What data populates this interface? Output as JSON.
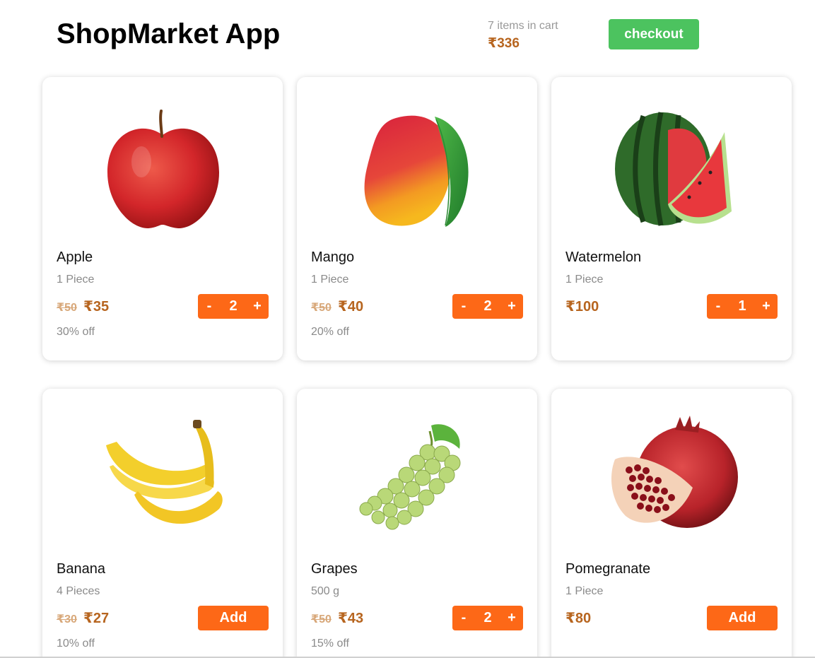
{
  "header": {
    "title": "ShopMarket App",
    "cart_count": "7 items in cart",
    "cart_total": "₹336",
    "checkout_label": "checkout"
  },
  "colors": {
    "accent_orange": "#fd6817",
    "checkout_green": "#4cc35f",
    "price_brown": "#b7651f"
  },
  "products": [
    {
      "name": "Apple",
      "unit": "1 Piece",
      "mrp": "₹50",
      "price": "₹35",
      "discount": "30% off",
      "qty": "2",
      "icon": "apple-icon"
    },
    {
      "name": "Mango",
      "unit": "1 Piece",
      "mrp": "₹50",
      "price": "₹40",
      "discount": "20% off",
      "qty": "2",
      "icon": "mango-icon"
    },
    {
      "name": "Watermelon",
      "unit": "1 Piece",
      "mrp": "",
      "price": "₹100",
      "discount": "",
      "qty": "1",
      "icon": "watermelon-icon"
    },
    {
      "name": "Banana",
      "unit": "4 Pieces",
      "mrp": "₹30",
      "price": "₹27",
      "discount": "10% off",
      "add_label": "Add",
      "icon": "banana-icon"
    },
    {
      "name": "Grapes",
      "unit": "500 g",
      "mrp": "₹50",
      "price": "₹43",
      "discount": "15% off",
      "qty": "2",
      "icon": "grapes-icon"
    },
    {
      "name": "Pomegranate",
      "unit": "1 Piece",
      "mrp": "",
      "price": "₹80",
      "discount": "",
      "add_label": "Add",
      "icon": "pomegranate-icon"
    }
  ],
  "stepper": {
    "minus": "-",
    "plus": "+"
  }
}
